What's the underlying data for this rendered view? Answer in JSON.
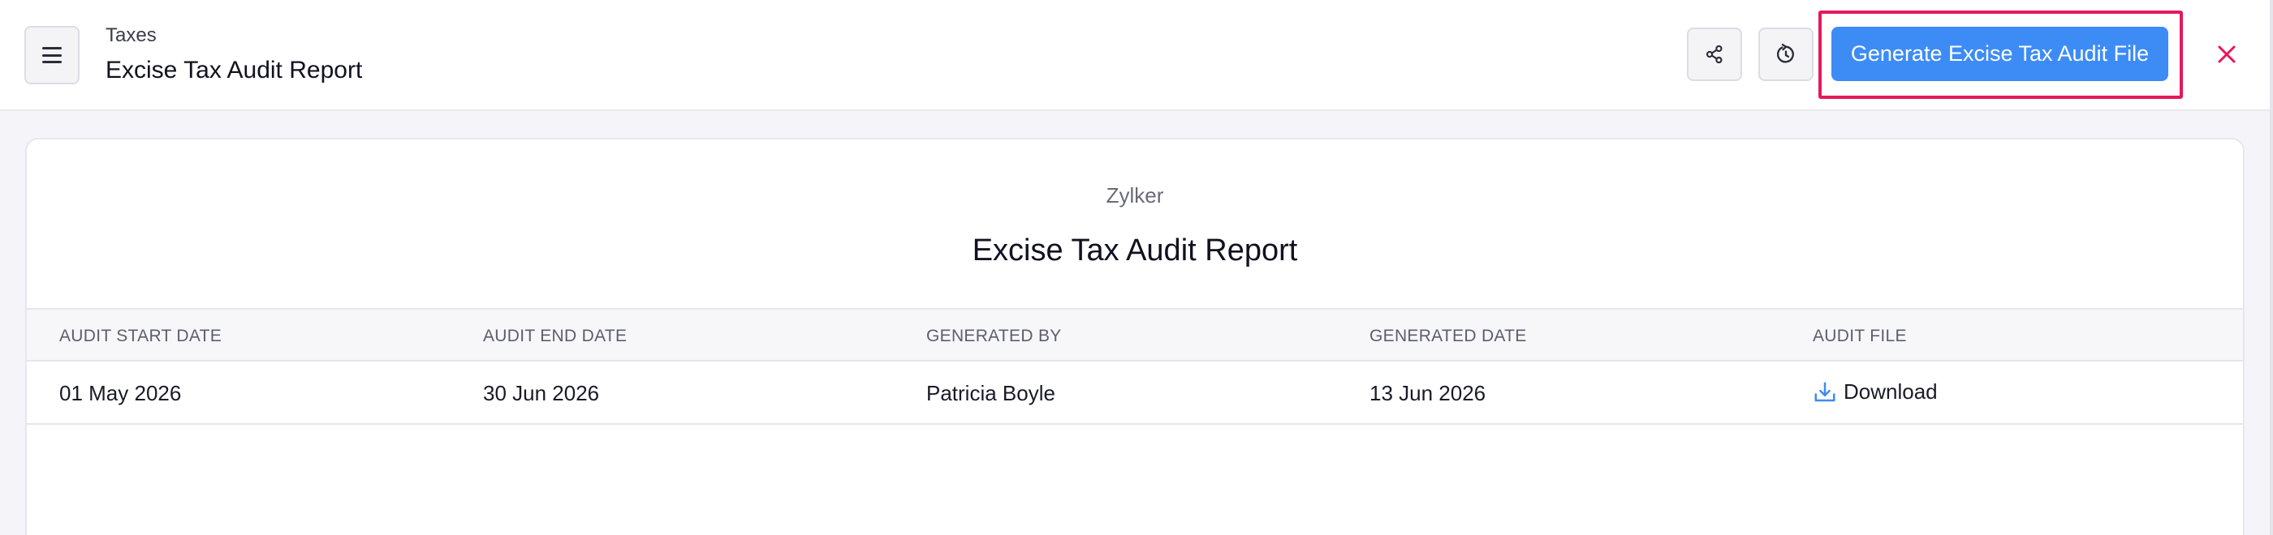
{
  "header": {
    "breadcrumb": "Taxes",
    "title": "Excise Tax Audit Report",
    "generate_label": "Generate Excise Tax Audit File",
    "icons": {
      "menu": "hamburger-menu-icon",
      "share": "share-icon",
      "refresh": "refresh-icon",
      "close": "close-icon"
    }
  },
  "report": {
    "org_name": "Zylker",
    "title": "Excise Tax Audit Report",
    "columns": [
      "AUDIT START DATE",
      "AUDIT END DATE",
      "GENERATED BY",
      "GENERATED DATE",
      "AUDIT FILE"
    ],
    "rows": [
      {
        "audit_start_date": "01 May 2026",
        "audit_end_date": "30 Jun 2026",
        "generated_by": "Patricia Boyle",
        "generated_date": "13 Jun 2026",
        "audit_file": "Download"
      }
    ]
  },
  "colors": {
    "accent": "#3d8cf5",
    "highlight": "#e5185b",
    "close": "#e5185b"
  }
}
